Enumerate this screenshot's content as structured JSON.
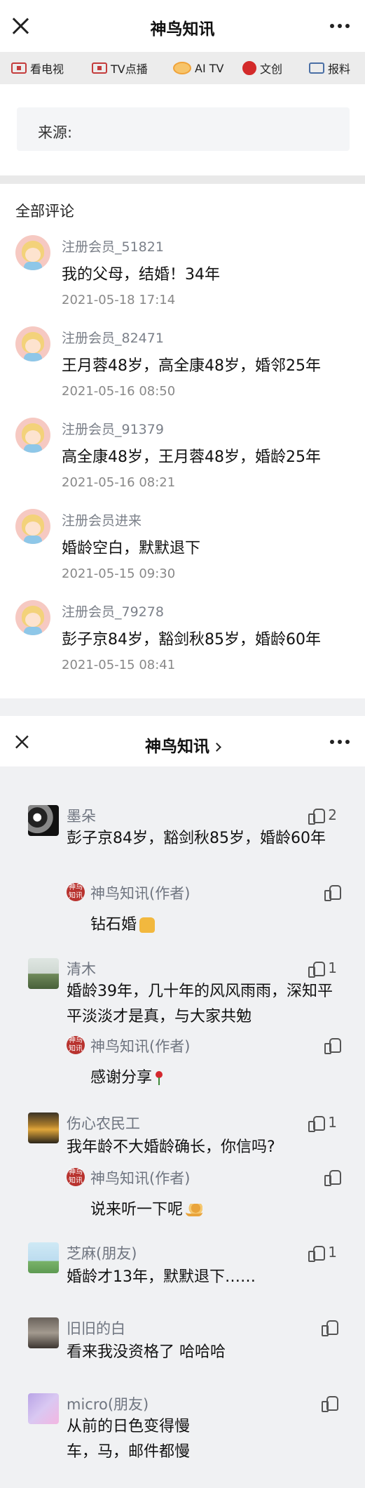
{
  "section1": {
    "header": {
      "title": "神鸟知讯"
    },
    "tabs": [
      {
        "label": "看电视",
        "icon": "tv-icon"
      },
      {
        "label": "TV点播",
        "icon": "tv-vod-icon"
      },
      {
        "label": "AI TV",
        "icon": "ai-tv-icon"
      },
      {
        "label": "文创",
        "icon": "wenchuang-icon"
      },
      {
        "label": "报料",
        "icon": "report-icon"
      }
    ],
    "source_label": "来源:",
    "all_comments_label": "全部评论",
    "comments": [
      {
        "user": "注册会员_51821",
        "text": "我的父母，结婚！34年",
        "time": "2021-05-18 17:14"
      },
      {
        "user": "注册会员_82471",
        "text": "王月蓉48岁，高全康48岁，婚邻25年",
        "time": "2021-05-16 08:50"
      },
      {
        "user": "注册会员_91379",
        "text": "高全康48岁，王月蓉48岁，婚龄25年",
        "time": "2021-05-16 08:21"
      },
      {
        "user": "注册会员进来",
        "text": "婚龄空白，默默退下",
        "time": "2021-05-15 09:30"
      },
      {
        "user": "注册会员_79278",
        "text": "彭子京84岁，豁剑秋85岁，婚龄60年",
        "time": "2021-05-15 08:41"
      }
    ]
  },
  "section2": {
    "header": {
      "title": "神鸟知讯"
    },
    "comments": [
      {
        "user": "墨朵",
        "likes": "2",
        "text": "彭子京84岁，豁剑秋85岁，婚龄60年",
        "reply": {
          "author": "神鸟知讯(作者)",
          "badge": "神鸟知讯",
          "text": "钻石婚"
        }
      },
      {
        "user": "清木",
        "likes": "1",
        "text": "婚龄39年，几十年的风风雨雨，深知平平淡淡才是真，与大家共勉",
        "reply": {
          "author": "神鸟知讯(作者)",
          "badge": "神鸟知讯",
          "text": "感谢分享"
        }
      },
      {
        "user": "伤心农民工",
        "likes": "1",
        "text": "我年龄不大婚龄确长，你信吗?",
        "reply": {
          "author": "神鸟知讯(作者)",
          "badge": "神鸟知讯",
          "text": "说来听一下呢"
        }
      },
      {
        "user": "芝麻(朋友)",
        "likes": "1",
        "text": "婚龄才13年，默默退下……"
      },
      {
        "user": "旧旧的白",
        "likes": "",
        "text": "看来我没资格了 哈哈哈"
      },
      {
        "user": "micro(朋友)",
        "likes": "",
        "text": "从前的日色变得慢\n车，马，邮件都慢"
      }
    ]
  }
}
